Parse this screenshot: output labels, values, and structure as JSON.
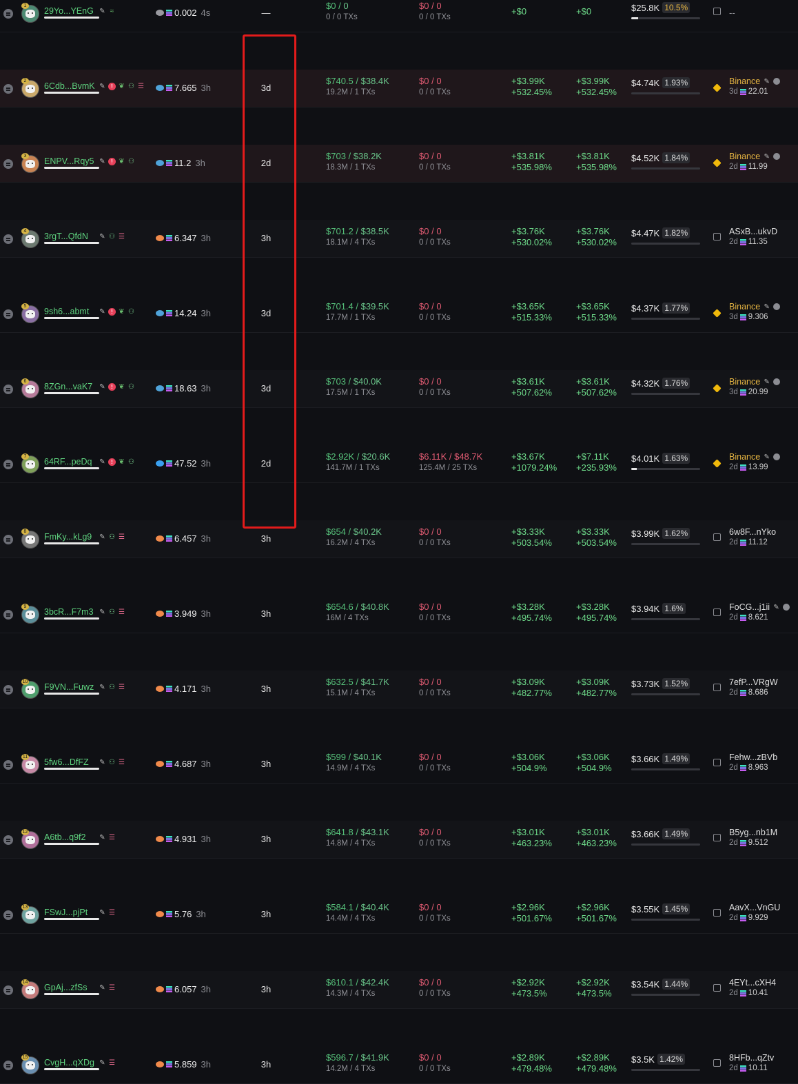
{
  "colors": {
    "accent_green": "#56c07a",
    "accent_red": "#e05b72",
    "binance": "#e3b341",
    "highlight_box": "#e31b1b"
  },
  "rows": [
    {
      "rank": "1",
      "name": "29Yo...YEnG",
      "icons": [
        "pencil-icon",
        "wave-icon"
      ],
      "src_icon": "clipboard-icon",
      "balance": "0.002",
      "bal_age": "4s",
      "hold": "—",
      "buy_usd": "$0",
      "buy_total": "0",
      "buy_sub": "0 / 0 TXs",
      "sell_usd": "$0",
      "sell_total": "0",
      "sell_sub": "0 / 0 TXs",
      "pnl_a": "+$0",
      "pnl_a_pct": "",
      "pnl_b": "+$0",
      "pnl_b_pct": "",
      "total": "$25.8K",
      "total_pct": "10.5%",
      "bar": 0.1,
      "source": "--",
      "source_type": "single"
    },
    {
      "rank": "2",
      "name": "6Cdb...BvmK",
      "icons": [
        "pencil-icon",
        "alert-icon",
        "leaf-icon",
        "user-icon",
        "stack-icon"
      ],
      "src_icon": "fish-icon",
      "balance": "7.665",
      "bal_age": "3h",
      "hold": "3d",
      "buy_usd": "$740.5",
      "buy_total": "$38.4K",
      "buy_sub": "19.2M / 1 TXs",
      "sell_usd": "$0",
      "sell_total": "0",
      "sell_sub": "0 / 0 TXs",
      "pnl_a": "+$3.99K",
      "pnl_a_pct": "+532.45%",
      "pnl_b": "+$3.99K",
      "pnl_b_pct": "+532.45%",
      "total": "$4.74K",
      "total_pct": "1.93%",
      "bar": 0.0,
      "source": "Binance",
      "source_type": "binance",
      "src_age": "3d",
      "src_val": "22.01"
    },
    {
      "rank": "3",
      "name": "ENPV...Rqy5",
      "icons": [
        "pencil-icon",
        "alert-icon",
        "leaf-icon",
        "user-icon"
      ],
      "src_icon": "fish-icon",
      "balance": "11.2",
      "bal_age": "3h",
      "hold": "2d",
      "buy_usd": "$703",
      "buy_total": "$38.2K",
      "buy_sub": "18.3M / 1 TXs",
      "sell_usd": "$0",
      "sell_total": "0",
      "sell_sub": "0 / 0 TXs",
      "pnl_a": "+$3.81K",
      "pnl_a_pct": "+535.98%",
      "pnl_b": "+$3.81K",
      "pnl_b_pct": "+535.98%",
      "total": "$4.52K",
      "total_pct": "1.84%",
      "bar": 0.0,
      "source": "Binance",
      "source_type": "binance",
      "src_age": "2d",
      "src_val": "11.99"
    },
    {
      "rank": "4",
      "name": "3rgT...QfdN",
      "icons": [
        "pencil-icon",
        "user-icon",
        "stack-icon"
      ],
      "src_icon": "shrimp-icon",
      "balance": "6.347",
      "bal_age": "3h",
      "hold": "3h",
      "buy_usd": "$701.2",
      "buy_total": "$38.5K",
      "buy_sub": "18.1M / 4 TXs",
      "sell_usd": "$0",
      "sell_total": "0",
      "sell_sub": "0 / 0 TXs",
      "pnl_a": "+$3.76K",
      "pnl_a_pct": "+530.02%",
      "pnl_b": "+$3.76K",
      "pnl_b_pct": "+530.02%",
      "total": "$4.47K",
      "total_pct": "1.82%",
      "bar": 0.0,
      "source": "ASxB...ukvD",
      "source_type": "wallet",
      "src_age": "2d",
      "src_val": "11.35"
    },
    {
      "rank": "5",
      "name": "9sh6...abmt",
      "icons": [
        "pencil-icon",
        "alert-icon",
        "leaf-icon",
        "user-icon"
      ],
      "src_icon": "fish-icon",
      "balance": "14.24",
      "bal_age": "3h",
      "hold": "3d",
      "buy_usd": "$701.4",
      "buy_total": "$39.5K",
      "buy_sub": "17.7M / 1 TXs",
      "sell_usd": "$0",
      "sell_total": "0",
      "sell_sub": "0 / 0 TXs",
      "pnl_a": "+$3.65K",
      "pnl_a_pct": "+515.33%",
      "pnl_b": "+$3.65K",
      "pnl_b_pct": "+515.33%",
      "total": "$4.37K",
      "total_pct": "1.77%",
      "bar": 0.0,
      "source": "Binance",
      "source_type": "binance",
      "src_age": "3d",
      "src_val": "9.306"
    },
    {
      "rank": "6",
      "name": "8ZGn...vaK7",
      "icons": [
        "pencil-icon",
        "alert-icon",
        "leaf-icon",
        "user-icon"
      ],
      "src_icon": "fish-icon",
      "balance": "18.63",
      "bal_age": "3h",
      "hold": "3d",
      "buy_usd": "$703",
      "buy_total": "$40.0K",
      "buy_sub": "17.5M / 1 TXs",
      "sell_usd": "$0",
      "sell_total": "0",
      "sell_sub": "0 / 0 TXs",
      "pnl_a": "+$3.61K",
      "pnl_a_pct": "+507.62%",
      "pnl_b": "+$3.61K",
      "pnl_b_pct": "+507.62%",
      "total": "$4.32K",
      "total_pct": "1.76%",
      "bar": 0.0,
      "source": "Binance",
      "source_type": "binance",
      "src_age": "3d",
      "src_val": "20.99"
    },
    {
      "rank": "7",
      "name": "64RF...peDq",
      "icons": [
        "pencil-icon",
        "alert-icon",
        "leaf-icon",
        "user-icon"
      ],
      "src_icon": "dolphin-icon",
      "balance": "47.52",
      "bal_age": "3h",
      "hold": "2d",
      "buy_usd": "$2.92K",
      "buy_total": "$20.6K",
      "buy_sub": "141.7M / 1 TXs",
      "sell_usd": "$6.11K",
      "sell_total": "$48.7K",
      "sell_sub": "125.4M / 25 TXs",
      "pnl_a": "+$3.67K",
      "pnl_a_pct": "+1079.24%",
      "pnl_b": "+$7.11K",
      "pnl_b_pct": "+235.93%",
      "total": "$4.01K",
      "total_pct": "1.63%",
      "bar": 0.08,
      "source": "Binance",
      "source_type": "binance",
      "src_age": "2d",
      "src_val": "13.99"
    },
    {
      "rank": "8",
      "name": "FmKy...kLg9",
      "icons": [
        "pencil-icon",
        "user-icon",
        "stack-icon"
      ],
      "src_icon": "shrimp-icon",
      "balance": "6.457",
      "bal_age": "3h",
      "hold": "3h",
      "buy_usd": "$654",
      "buy_total": "$40.2K",
      "buy_sub": "16.2M / 4 TXs",
      "sell_usd": "$0",
      "sell_total": "0",
      "sell_sub": "0 / 0 TXs",
      "pnl_a": "+$3.33K",
      "pnl_a_pct": "+503.54%",
      "pnl_b": "+$3.33K",
      "pnl_b_pct": "+503.54%",
      "total": "$3.99K",
      "total_pct": "1.62%",
      "bar": 0.0,
      "source": "6w8F...nYko",
      "source_type": "wallet",
      "src_age": "2d",
      "src_val": "11.12"
    },
    {
      "rank": "9",
      "name": "3bcR...F7m3",
      "icons": [
        "pencil-icon",
        "user-icon",
        "stack-icon"
      ],
      "src_icon": "shrimp-icon",
      "balance": "3.949",
      "bal_age": "3h",
      "hold": "3h",
      "buy_usd": "$654.6",
      "buy_total": "$40.8K",
      "buy_sub": "16M / 4 TXs",
      "sell_usd": "$0",
      "sell_total": "0",
      "sell_sub": "0 / 0 TXs",
      "pnl_a": "+$3.28K",
      "pnl_a_pct": "+495.74%",
      "pnl_b": "+$3.28K",
      "pnl_b_pct": "+495.74%",
      "total": "$3.94K",
      "total_pct": "1.6%",
      "bar": 0.0,
      "source": "FoCG...j1ii",
      "source_type": "wallet-edit",
      "src_age": "2d",
      "src_val": "8.621"
    },
    {
      "rank": "10",
      "name": "F9VN...Fuwz",
      "icons": [
        "pencil-icon",
        "user-icon",
        "stack-icon"
      ],
      "src_icon": "shrimp-icon",
      "balance": "4.171",
      "bal_age": "3h",
      "hold": "3h",
      "buy_usd": "$632.5",
      "buy_total": "$41.7K",
      "buy_sub": "15.1M / 4 TXs",
      "sell_usd": "$0",
      "sell_total": "0",
      "sell_sub": "0 / 0 TXs",
      "pnl_a": "+$3.09K",
      "pnl_a_pct": "+482.77%",
      "pnl_b": "+$3.09K",
      "pnl_b_pct": "+482.77%",
      "total": "$3.73K",
      "total_pct": "1.52%",
      "bar": 0.0,
      "source": "7efP...VRgW",
      "source_type": "wallet",
      "src_age": "2d",
      "src_val": "8.686"
    },
    {
      "rank": "11",
      "name": "5fw6...DfFZ",
      "icons": [
        "pencil-icon",
        "user-icon",
        "stack-icon"
      ],
      "src_icon": "shrimp-icon",
      "balance": "4.687",
      "bal_age": "3h",
      "hold": "3h",
      "buy_usd": "$599",
      "buy_total": "$40.1K",
      "buy_sub": "14.9M / 4 TXs",
      "sell_usd": "$0",
      "sell_total": "0",
      "sell_sub": "0 / 0 TXs",
      "pnl_a": "+$3.06K",
      "pnl_a_pct": "+504.9%",
      "pnl_b": "+$3.06K",
      "pnl_b_pct": "+504.9%",
      "total": "$3.66K",
      "total_pct": "1.49%",
      "bar": 0.0,
      "source": "Fehw...zBVb",
      "source_type": "wallet",
      "src_age": "2d",
      "src_val": "8.963"
    },
    {
      "rank": "12",
      "name": "A6tb...q9f2",
      "icons": [
        "pencil-icon",
        "stack-icon"
      ],
      "src_icon": "shrimp-icon",
      "balance": "4.931",
      "bal_age": "3h",
      "hold": "3h",
      "buy_usd": "$641.8",
      "buy_total": "$43.1K",
      "buy_sub": "14.8M / 4 TXs",
      "sell_usd": "$0",
      "sell_total": "0",
      "sell_sub": "0 / 0 TXs",
      "pnl_a": "+$3.01K",
      "pnl_a_pct": "+463.23%",
      "pnl_b": "+$3.01K",
      "pnl_b_pct": "+463.23%",
      "total": "$3.66K",
      "total_pct": "1.49%",
      "bar": 0.0,
      "source": "B5yg...nb1M",
      "source_type": "wallet",
      "src_age": "2d",
      "src_val": "9.512"
    },
    {
      "rank": "13",
      "name": "FSwJ...pjPt",
      "icons": [
        "pencil-icon",
        "stack-icon"
      ],
      "src_icon": "shrimp-icon",
      "balance": "5.76",
      "bal_age": "3h",
      "hold": "3h",
      "buy_usd": "$584.1",
      "buy_total": "$40.4K",
      "buy_sub": "14.4M / 4 TXs",
      "sell_usd": "$0",
      "sell_total": "0",
      "sell_sub": "0 / 0 TXs",
      "pnl_a": "+$2.96K",
      "pnl_a_pct": "+501.67%",
      "pnl_b": "+$2.96K",
      "pnl_b_pct": "+501.67%",
      "total": "$3.55K",
      "total_pct": "1.45%",
      "bar": 0.0,
      "source": "AavX...VnGU",
      "source_type": "wallet",
      "src_age": "2d",
      "src_val": "9.929"
    },
    {
      "rank": "14",
      "name": "GpAj...zfSs",
      "icons": [
        "pencil-icon",
        "stack-icon"
      ],
      "src_icon": "shrimp-icon",
      "balance": "6.057",
      "bal_age": "3h",
      "hold": "3h",
      "buy_usd": "$610.1",
      "buy_total": "$42.4K",
      "buy_sub": "14.3M / 4 TXs",
      "sell_usd": "$0",
      "sell_total": "0",
      "sell_sub": "0 / 0 TXs",
      "pnl_a": "+$2.92K",
      "pnl_a_pct": "+473.5%",
      "pnl_b": "+$2.92K",
      "pnl_b_pct": "+473.5%",
      "total": "$3.54K",
      "total_pct": "1.44%",
      "bar": 0.0,
      "source": "4EYt...cXH4",
      "source_type": "wallet",
      "src_age": "2d",
      "src_val": "10.41"
    },
    {
      "rank": "15",
      "name": "CvgH...qXDg",
      "icons": [
        "pencil-icon",
        "stack-icon"
      ],
      "src_icon": "shrimp-icon",
      "balance": "5.859",
      "bal_age": "3h",
      "hold": "3h",
      "buy_usd": "$596.7",
      "buy_total": "$41.9K",
      "buy_sub": "14.2M / 4 TXs",
      "sell_usd": "$0",
      "sell_total": "0",
      "sell_sub": "0 / 0 TXs",
      "pnl_a": "+$2.89K",
      "pnl_a_pct": "+479.48%",
      "pnl_b": "+$2.89K",
      "pnl_b_pct": "+479.48%",
      "total": "$3.5K",
      "total_pct": "1.42%",
      "bar": 0.0,
      "source": "8HFb...qZtv",
      "source_type": "wallet",
      "src_age": "2d",
      "src_val": "10.11"
    }
  ]
}
